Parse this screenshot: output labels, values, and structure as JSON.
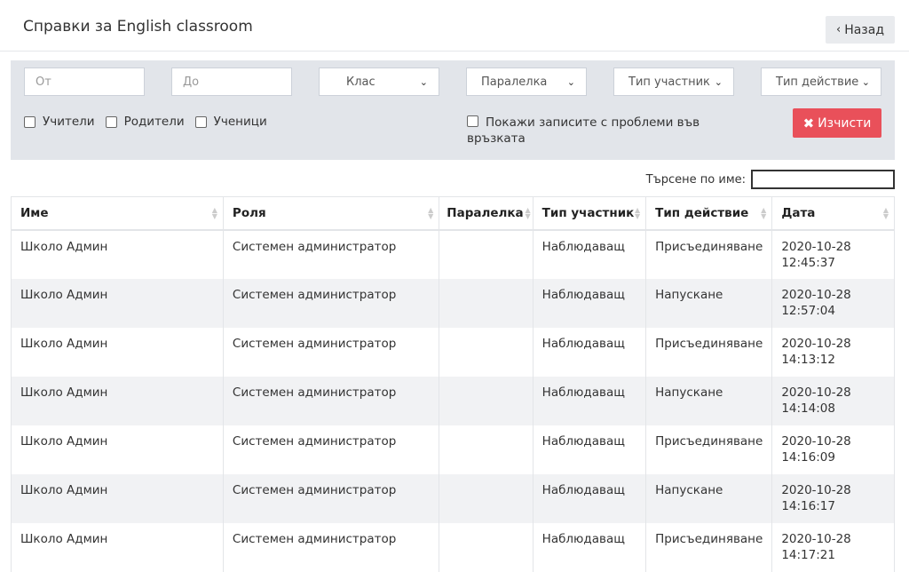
{
  "header": {
    "title": "Справки за English classroom",
    "back_label": "Назад"
  },
  "filters": {
    "from_placeholder": "От",
    "to_placeholder": "До",
    "class_label": "Клас",
    "parallel_label": "Паралелка",
    "participant_type_label": "Тип участник",
    "action_type_label": "Тип действие",
    "checkboxes": [
      "Учители",
      "Родители",
      "Ученици"
    ],
    "connection_problems_label": "Покажи записите с проблеми във връзката",
    "clear_label": "Изчисти"
  },
  "search": {
    "label": "Търсене по име:"
  },
  "table": {
    "columns": [
      "Име",
      "Роля",
      "Паралелка",
      "Тип участник",
      "Тип действие",
      "Дата"
    ],
    "rows": [
      [
        "Школо Админ",
        "Системен администратор",
        "",
        "Наблюдаващ",
        "Присъединяване",
        "2020-10-28",
        "12:45:37"
      ],
      [
        "Школо Админ",
        "Системен администратор",
        "",
        "Наблюдаващ",
        "Напускане",
        "2020-10-28",
        "12:57:04"
      ],
      [
        "Школо Админ",
        "Системен администратор",
        "",
        "Наблюдаващ",
        "Присъединяване",
        "2020-10-28",
        "14:13:12"
      ],
      [
        "Школо Админ",
        "Системен администратор",
        "",
        "Наблюдаващ",
        "Напускане",
        "2020-10-28",
        "14:14:08"
      ],
      [
        "Школо Админ",
        "Системен администратор",
        "",
        "Наблюдаващ",
        "Присъединяване",
        "2020-10-28",
        "14:16:09"
      ],
      [
        "Школо Админ",
        "Системен администратор",
        "",
        "Наблюдаващ",
        "Напускане",
        "2020-10-28",
        "14:16:17"
      ],
      [
        "Школо Админ",
        "Системен администратор",
        "",
        "Наблюдаващ",
        "Присъединяване",
        "2020-10-28",
        "14:17:21"
      ]
    ]
  },
  "colors": {
    "clear_button": "#e9505a",
    "filter_bg": "#e2e5ea"
  }
}
